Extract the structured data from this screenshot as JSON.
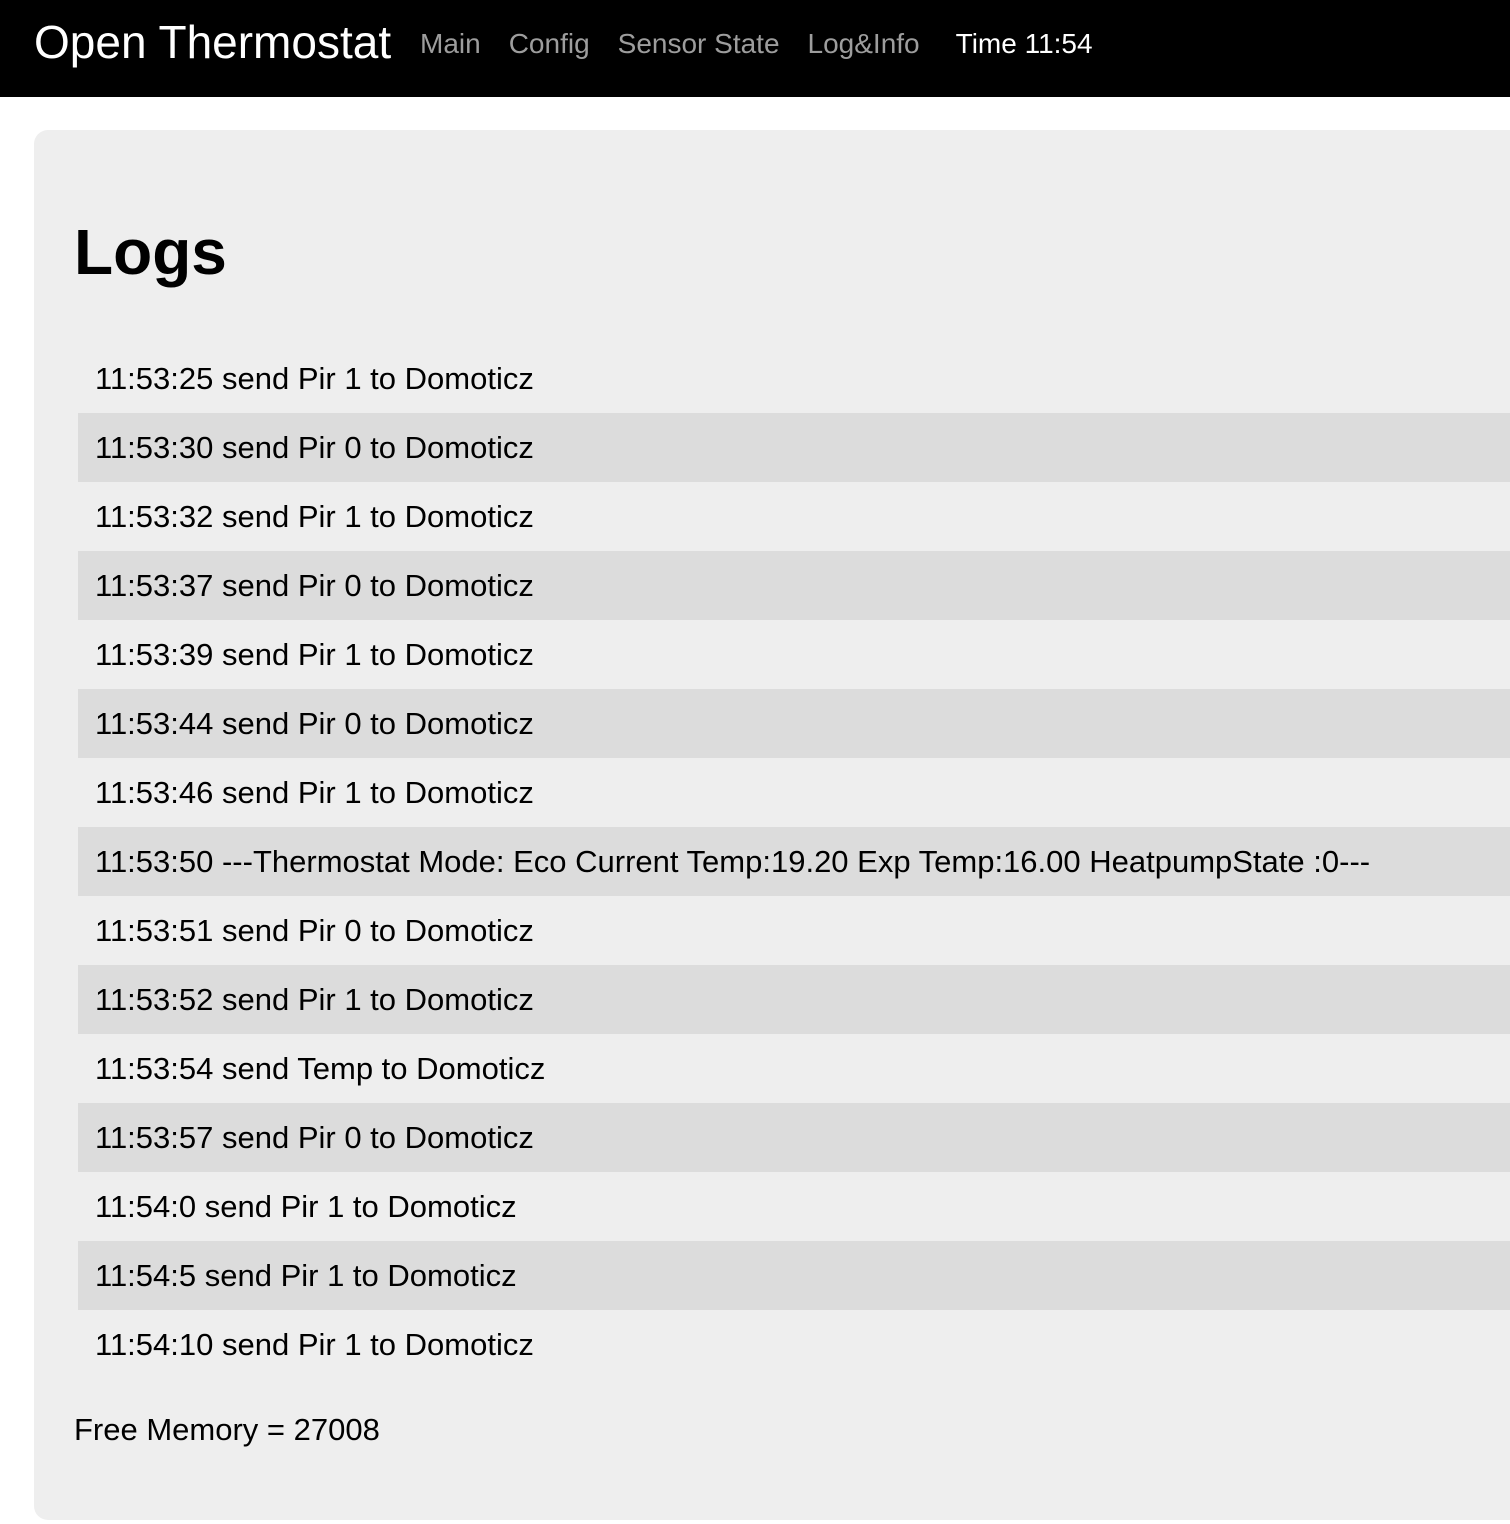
{
  "navbar": {
    "brand": "Open Thermostat",
    "links": [
      {
        "label": "Main"
      },
      {
        "label": "Config"
      },
      {
        "label": "Sensor State"
      },
      {
        "label": "Log&Info"
      }
    ],
    "time": "Time 11:54"
  },
  "page": {
    "title": "Logs"
  },
  "logs": [
    "11:53:25 send Pir 1 to Domoticz",
    "11:53:30 send Pir 0 to Domoticz",
    "11:53:32 send Pir 1 to Domoticz",
    "11:53:37 send Pir 0 to Domoticz",
    "11:53:39 send Pir 1 to Domoticz",
    "11:53:44 send Pir 0 to Domoticz",
    "11:53:46 send Pir 1 to Domoticz",
    "11:53:50 ---Thermostat Mode: Eco Current Temp:19.20 Exp Temp:16.00 HeatpumpState :0---",
    "11:53:51 send Pir 0 to Domoticz",
    "11:53:52 send Pir 1 to Domoticz",
    "11:53:54 send Temp to Domoticz",
    "11:53:57 send Pir 0 to Domoticz",
    "11:54:0 send Pir 1 to Domoticz",
    "11:54:5 send Pir 1 to Domoticz",
    "11:54:10 send Pir 1 to Domoticz"
  ],
  "footer": {
    "free_memory": "Free Memory = 27008"
  },
  "colors": {
    "navbar_bg": "#000000",
    "nav_link": "#9d9d9d",
    "panel_bg": "#eeeeee",
    "stripe_bg": "#dcdcdc"
  }
}
